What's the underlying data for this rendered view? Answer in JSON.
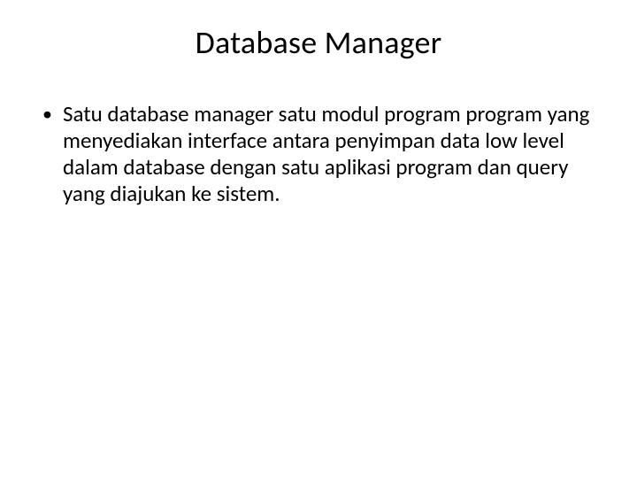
{
  "slide": {
    "title": "Database Manager",
    "bullets": [
      {
        "text": "Satu database manager satu modul program program yang menyediakan interface antara penyimpan data low level dalam database dengan satu aplikasi program dan query yang diajukan ke sistem."
      }
    ]
  }
}
